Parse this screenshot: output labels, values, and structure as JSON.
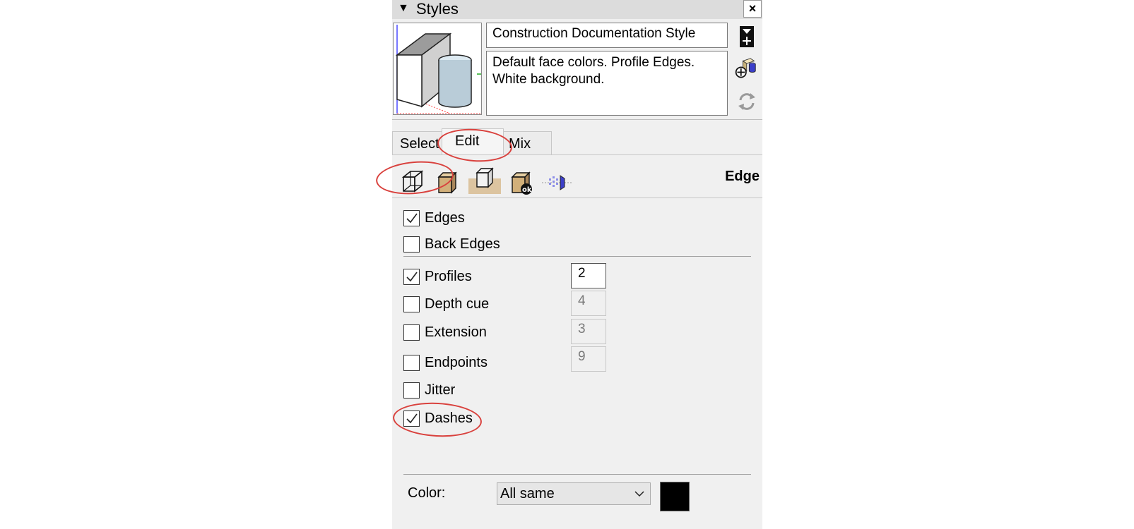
{
  "panel": {
    "title": "Styles",
    "collapse_icon": "triangle-down-icon",
    "close_label": "×"
  },
  "style": {
    "name": "Construction Documentation Style",
    "description": "Default face colors. Profile Edges. White background."
  },
  "side_icons": [
    "create-style-icon",
    "add-to-model-icon",
    "update-style-icon"
  ],
  "tabs": [
    {
      "label": "Select",
      "active": false
    },
    {
      "label": "Edit",
      "active": true
    },
    {
      "label": "Mix",
      "active": false
    }
  ],
  "toolbar": {
    "section_title": "Edge",
    "tools": [
      {
        "name": "edge-settings-icon",
        "active": true
      },
      {
        "name": "face-settings-icon",
        "active": false
      },
      {
        "name": "background-settings-icon",
        "active": false
      },
      {
        "name": "watermark-settings-icon",
        "active": false
      },
      {
        "name": "modeling-settings-icon",
        "active": false
      }
    ]
  },
  "edge_settings": {
    "edges": {
      "label": "Edges",
      "checked": true
    },
    "back_edges": {
      "label": "Back Edges",
      "checked": false
    },
    "profiles": {
      "label": "Profiles",
      "checked": true,
      "value": "2"
    },
    "depth_cue": {
      "label": "Depth cue",
      "checked": false,
      "value": "4"
    },
    "extension": {
      "label": "Extension",
      "checked": false,
      "value": "3"
    },
    "endpoints": {
      "label": "Endpoints",
      "checked": false,
      "value": "9"
    },
    "jitter": {
      "label": "Jitter",
      "checked": false
    },
    "dashes": {
      "label": "Dashes",
      "checked": true
    }
  },
  "color": {
    "label": "Color:",
    "selected": "All same",
    "swatch": "#000000"
  },
  "colors": {
    "annotation": "#d9413d",
    "panel_bg": "#f0f0f0",
    "active_tool_bg": "#dcc4a0"
  }
}
